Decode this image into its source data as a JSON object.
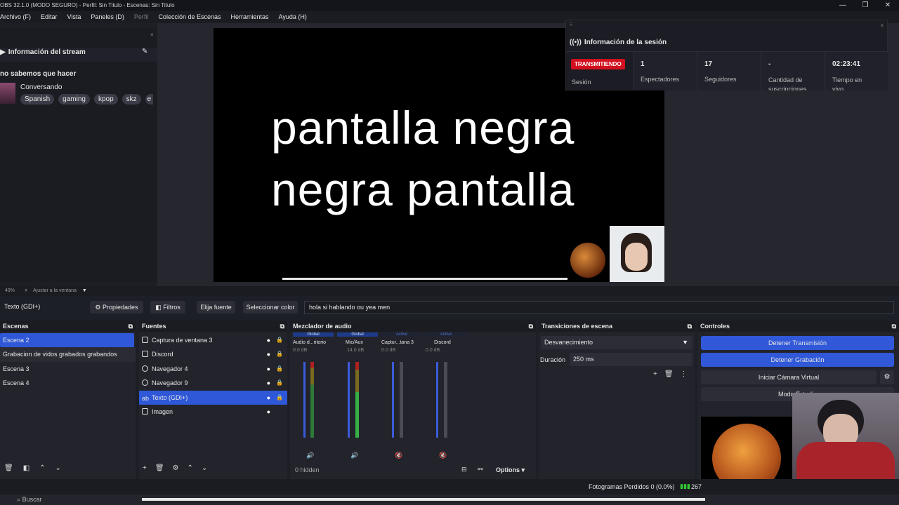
{
  "titlebar": {
    "text": "OBS 32.1.0 (MODO SEGURO) - Perfil: Sin Titulo - Escenas: Sin Titulo"
  },
  "menu": [
    "Archivo (F)",
    "Editar",
    "Vista",
    "Paneles (D)",
    "Perfil",
    "Colección de Escenas",
    "Herramientas",
    "Ayuda (H)"
  ],
  "stream_info": {
    "title": "Información del stream",
    "stream_title": "no sabemos que hacer",
    "category": "Conversando",
    "tags": [
      "Spanish",
      "gaming",
      "kpop",
      "skz",
      "e"
    ]
  },
  "preview": {
    "line1": "pantalla negra",
    "line2": "negra pantalla"
  },
  "session": {
    "title": "Información de la sesión",
    "status": "TRANSMITIENDO",
    "status_label": "Sesión",
    "stats": [
      {
        "value": "1",
        "label": "Espectadores"
      },
      {
        "value": "17",
        "label": "Seguidores"
      },
      {
        "value": "-",
        "label": "Cantidad de suscripciones"
      },
      {
        "value": "02:23:41",
        "label": "Tiempo en vivo"
      }
    ]
  },
  "zoom": {
    "percent": "49%",
    "fit": "Ajustar a la ventana"
  },
  "propbar": {
    "source": "Texto (GDI+)",
    "props": "Propiedades",
    "filters": "Filtros",
    "font": "Elija fuente",
    "color": "Seleccionar color",
    "text": "hola si hablando ou yea men"
  },
  "scenes": {
    "title": "Escenas",
    "items": [
      "Escena 2",
      "Grabacion de vidos grabados grabandos",
      "Escena 3",
      "Escena 4"
    ]
  },
  "sources": {
    "title": "Fuentes",
    "items": [
      "Captura de ventana 3",
      "Discord",
      "Navegador 4",
      "Navegador 9",
      "Texto (GDI+)",
      "Imagen"
    ]
  },
  "mixer": {
    "title": "Mezclador de audio",
    "hidden": "0 hidden",
    "options": "Options",
    "channels": [
      {
        "tag": "Global",
        "name": "Audio d...ritorio",
        "db": "0.0 dB"
      },
      {
        "tag": "Global",
        "name": "Mic/Aux",
        "db": "14.0 dB"
      },
      {
        "tag": "Active",
        "name": "Captur...tana 3",
        "db": "0.0 dB"
      },
      {
        "tag": "Active",
        "name": "Discord",
        "db": "0.0 dB"
      }
    ],
    "scale": [
      "0",
      "-6",
      "-12",
      "-18",
      "-24",
      "-30",
      "-36",
      "-42",
      "-48",
      "-54",
      "-60"
    ]
  },
  "transitions": {
    "title": "Transiciones de escena",
    "type": "Desvanecimiento",
    "duration_label": "Duración",
    "duration": "250 ms"
  },
  "controls": {
    "title": "Controles",
    "stop_stream": "Detener Transmisión",
    "stop_rec": "Detener Grabación",
    "virtual_cam": "Iniciar Cámara Virtual",
    "studio": "Modo Estudio"
  },
  "status": {
    "dropped": "Fotogramas Perdidos 0 (0.0%)",
    "bitrate": "267"
  },
  "taskbar": {
    "search": "Buscar"
  },
  "colors": {
    "accent": "#3058d8",
    "live": "#d20f1e"
  }
}
